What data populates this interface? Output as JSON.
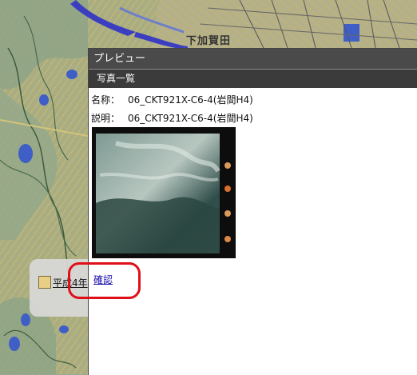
{
  "map": {
    "place_name": "下加賀田",
    "legend": {
      "label": "平成4年",
      "swatch_color": "#e9cf86"
    }
  },
  "preview": {
    "title": "プレビュー",
    "tab_label": "写真一覧",
    "name_label": "名称：",
    "name_value": "06_CKT921X-C6-4(岩間H4)",
    "desc_label": "説明：",
    "desc_value": "06_CKT921X-C6-4(岩間H4)",
    "confirm_label": "確認",
    "photo_icon": "aerial-photo"
  },
  "colors": {
    "titlebar": "#4a4a4a",
    "tabbar": "#3b3b3b",
    "annotation": "#e0101a",
    "link": "#1a0dab"
  }
}
